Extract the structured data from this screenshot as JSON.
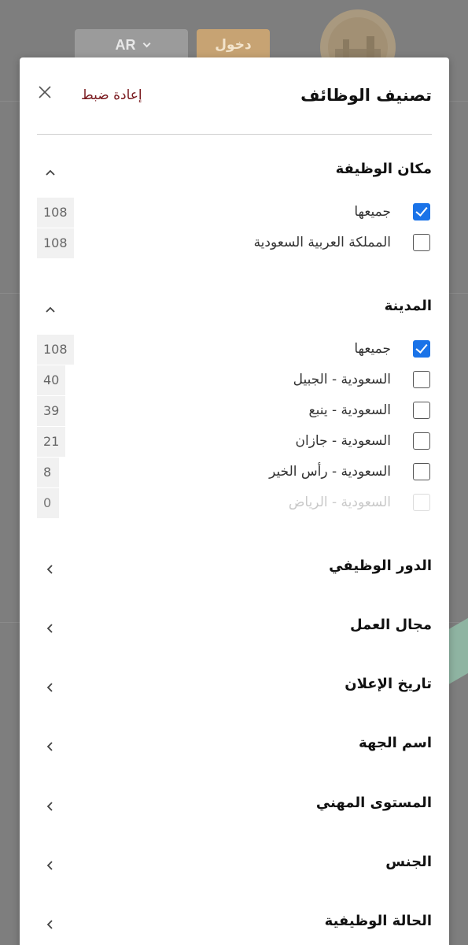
{
  "header": {
    "language_label": "AR",
    "login_label": "دخول"
  },
  "panel": {
    "title": "تصنيف الوظائف",
    "reset_label": "إعادة ضبط",
    "job_location": {
      "title": "مكان الوظيفة",
      "options": [
        {
          "label": "جميعها",
          "count": "108",
          "checked": true
        },
        {
          "label": "المملكة العربية السعودية",
          "count": "108",
          "checked": false
        }
      ]
    },
    "city": {
      "title": "المدينة",
      "options": [
        {
          "label": "جميعها",
          "count": "108",
          "checked": true
        },
        {
          "label": "السعودية - الجبيل",
          "count": "40",
          "checked": false
        },
        {
          "label": "السعودية - ينبع",
          "count": "39",
          "checked": false
        },
        {
          "label": "السعودية - جازان",
          "count": "21",
          "checked": false
        },
        {
          "label": "السعودية - رأس الخير",
          "count": "8",
          "checked": false
        },
        {
          "label": "السعودية - الرياض",
          "count": "0",
          "checked": false,
          "disabled": true
        }
      ]
    },
    "collapsed_sections": [
      {
        "title": "الدور الوظيفي"
      },
      {
        "title": "مجال العمل"
      },
      {
        "title": "تاريخ الإعلان"
      },
      {
        "title": "اسم الجهة"
      },
      {
        "title": "المستوى المهني"
      },
      {
        "title": "الجنس"
      },
      {
        "title": "الحالة الوظيفية"
      }
    ]
  },
  "colors": {
    "accent_checkbox": "#1a73e8",
    "reset_link": "#7a1a1f",
    "login_button": "#c7a373"
  }
}
